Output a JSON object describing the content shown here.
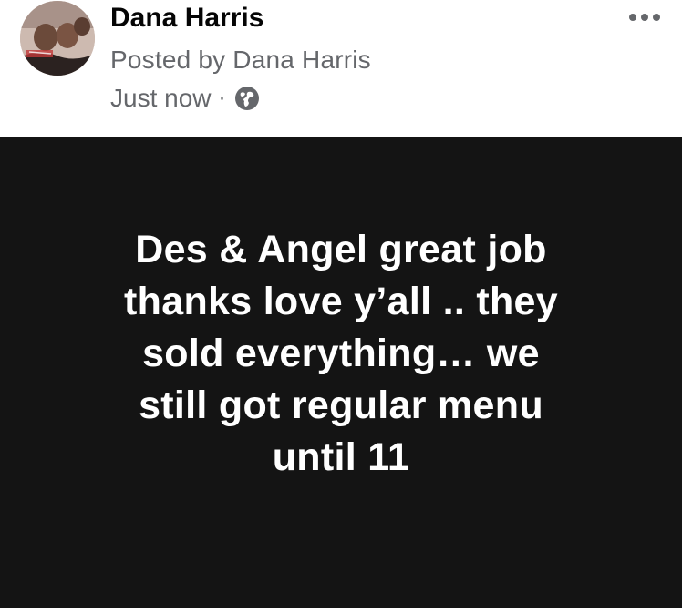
{
  "post": {
    "author_name": "Dana Harris",
    "posted_by": "Posted by Dana Harris",
    "timestamp": "Just now",
    "separator": "·",
    "audience_icon": "globe-icon",
    "more_icon": "more-options-icon",
    "body_text": "Des & Angel great job\nthanks love y’all .. they\nsold everything… we\nstill got regular menu\nuntil 11",
    "background_color": "#141414",
    "text_color": "#ffffff"
  }
}
